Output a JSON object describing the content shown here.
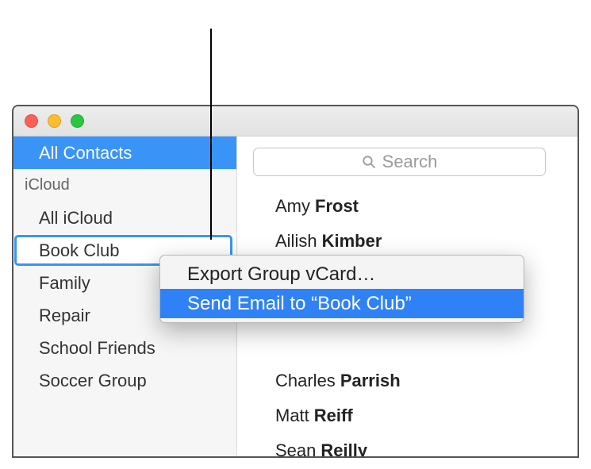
{
  "callout": true,
  "sidebar": {
    "top_item": "All Contacts",
    "section_header": "iCloud",
    "items": [
      {
        "label": "All iCloud"
      },
      {
        "label": "Book Club"
      },
      {
        "label": "Family"
      },
      {
        "label": "Repair"
      },
      {
        "label": "School Friends"
      },
      {
        "label": "Soccer Group"
      }
    ]
  },
  "search": {
    "placeholder": "Search"
  },
  "contacts": [
    {
      "first": "Amy",
      "last": "Frost"
    },
    {
      "first": "Ailish",
      "last": "Kimber"
    },
    {
      "first": "",
      "last": ""
    },
    {
      "first": "",
      "last": ""
    },
    {
      "first": "",
      "last": ""
    },
    {
      "first": "Charles",
      "last": "Parrish"
    },
    {
      "first": "Matt",
      "last": "Reiff"
    },
    {
      "first": "Sean",
      "last": "Reilly"
    }
  ],
  "context_menu": {
    "items": [
      {
        "label": "Export Group vCard…",
        "highlighted": false
      },
      {
        "label": "Send Email to “Book Club”",
        "highlighted": true
      }
    ]
  }
}
